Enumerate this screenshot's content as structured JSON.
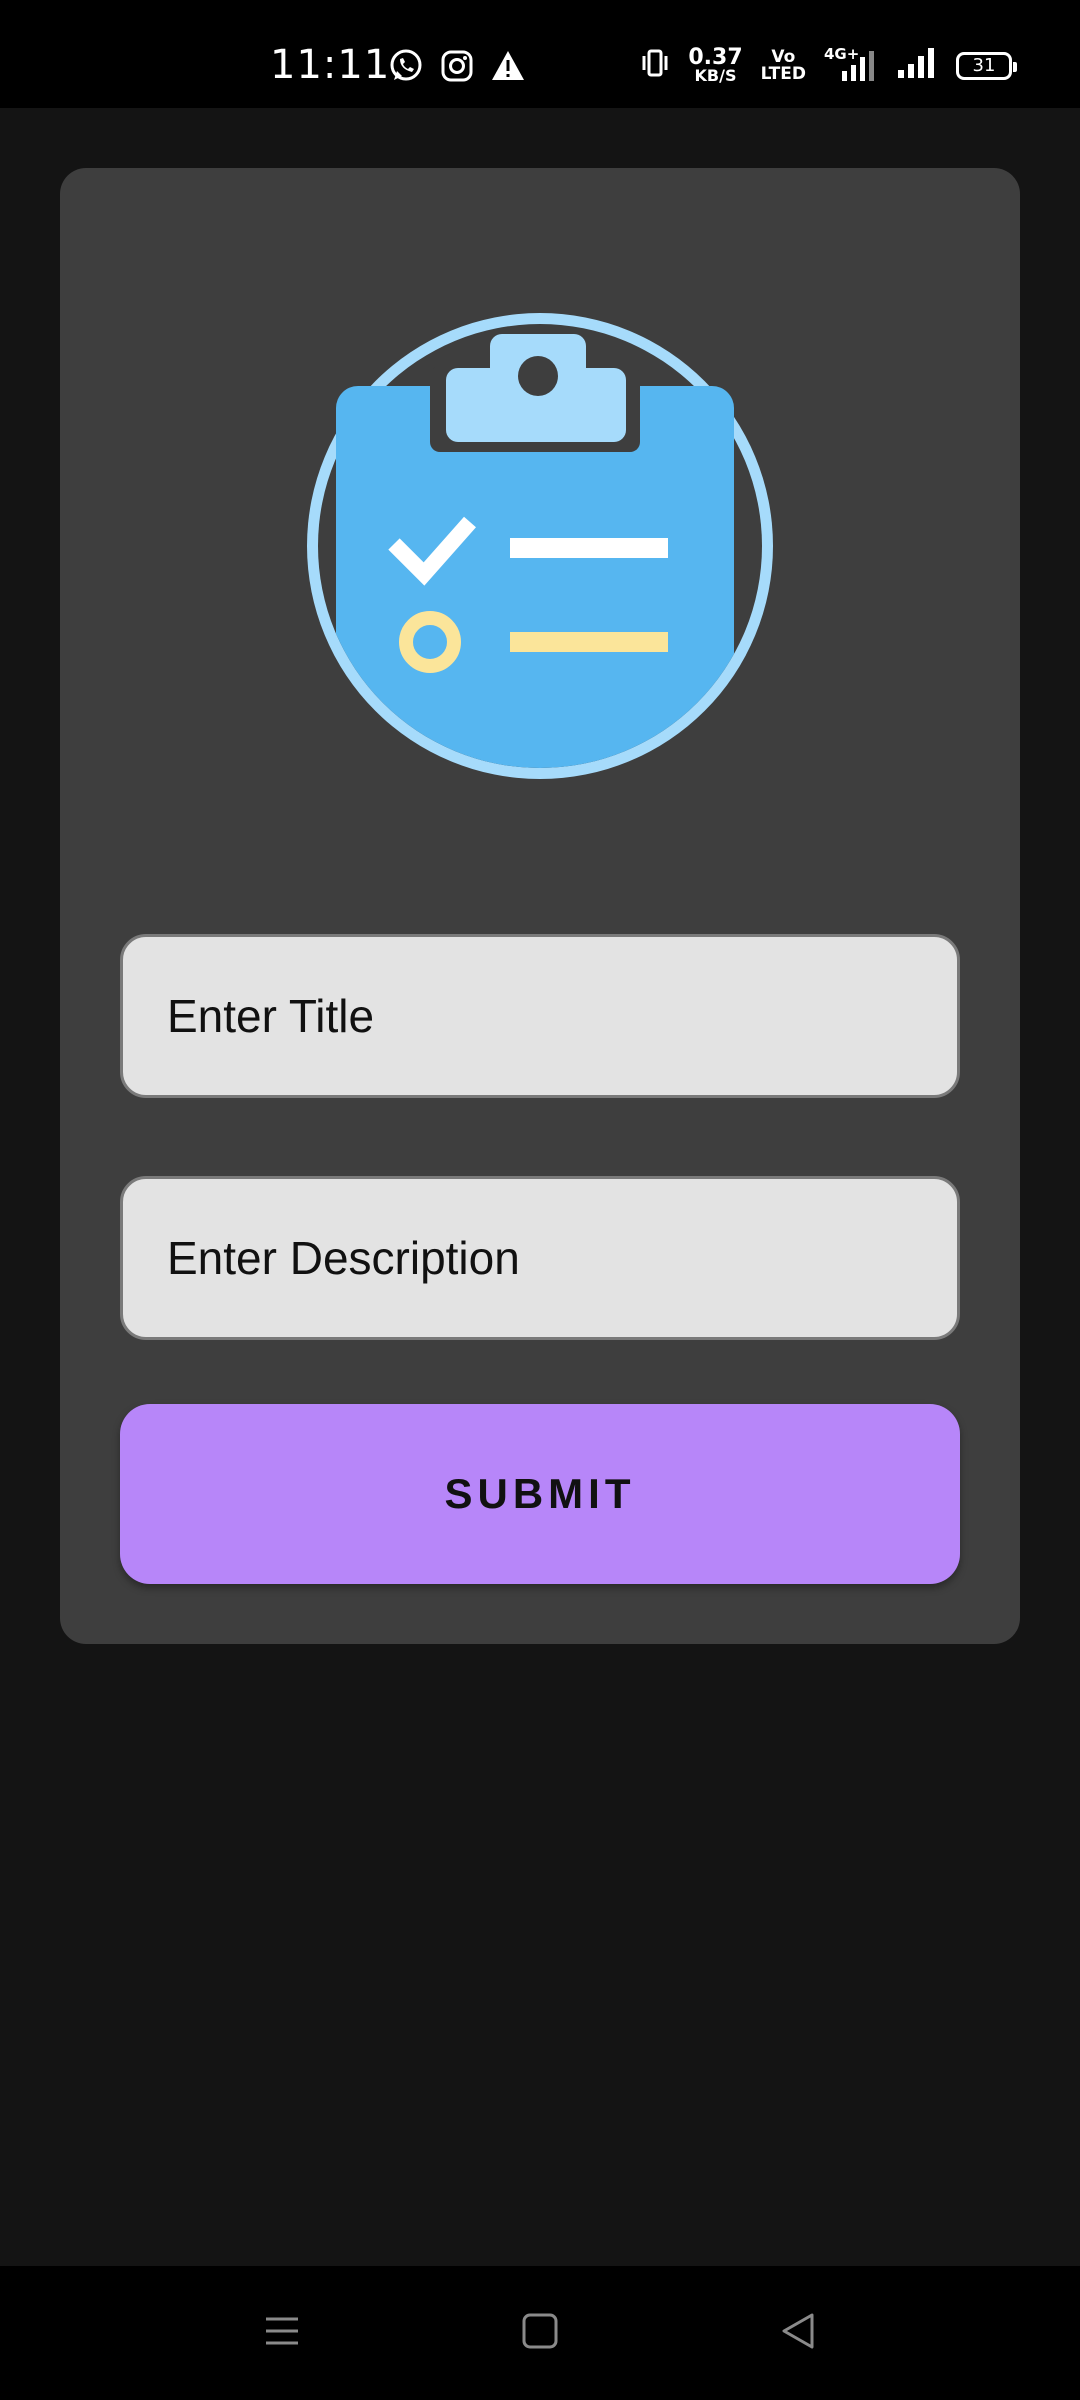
{
  "status_bar": {
    "time": "11:11",
    "net_speed_value": "0.37",
    "net_speed_unit": "KB/S",
    "volte_line1": "Vo",
    "volte_line2": "LTED",
    "network_type": "4G+",
    "battery_level": "31",
    "left_icons": [
      "whatsapp-icon",
      "instagram-icon",
      "warning-icon"
    ],
    "right_icons": [
      "vibrate-icon",
      "signal-4g-icon",
      "signal-icon",
      "battery-icon"
    ]
  },
  "form": {
    "illustration_icon": "clipboard-checklist-icon",
    "title_placeholder": "Enter Title",
    "title_value": "",
    "description_placeholder": "Enter Description",
    "description_value": "",
    "submit_label": "SUBMIT"
  },
  "nav_bar": {
    "icons": [
      "menu-icon",
      "home-icon",
      "back-icon"
    ]
  },
  "colors": {
    "background": "#141414",
    "card": "#3e3e3e",
    "input_background": "#e3e3e3",
    "submit_button": "#b786f9",
    "clipboard_blue": "#56b6f0",
    "clipboard_light_blue": "#a6dbfb",
    "accent_yellow": "#fbe59a"
  }
}
